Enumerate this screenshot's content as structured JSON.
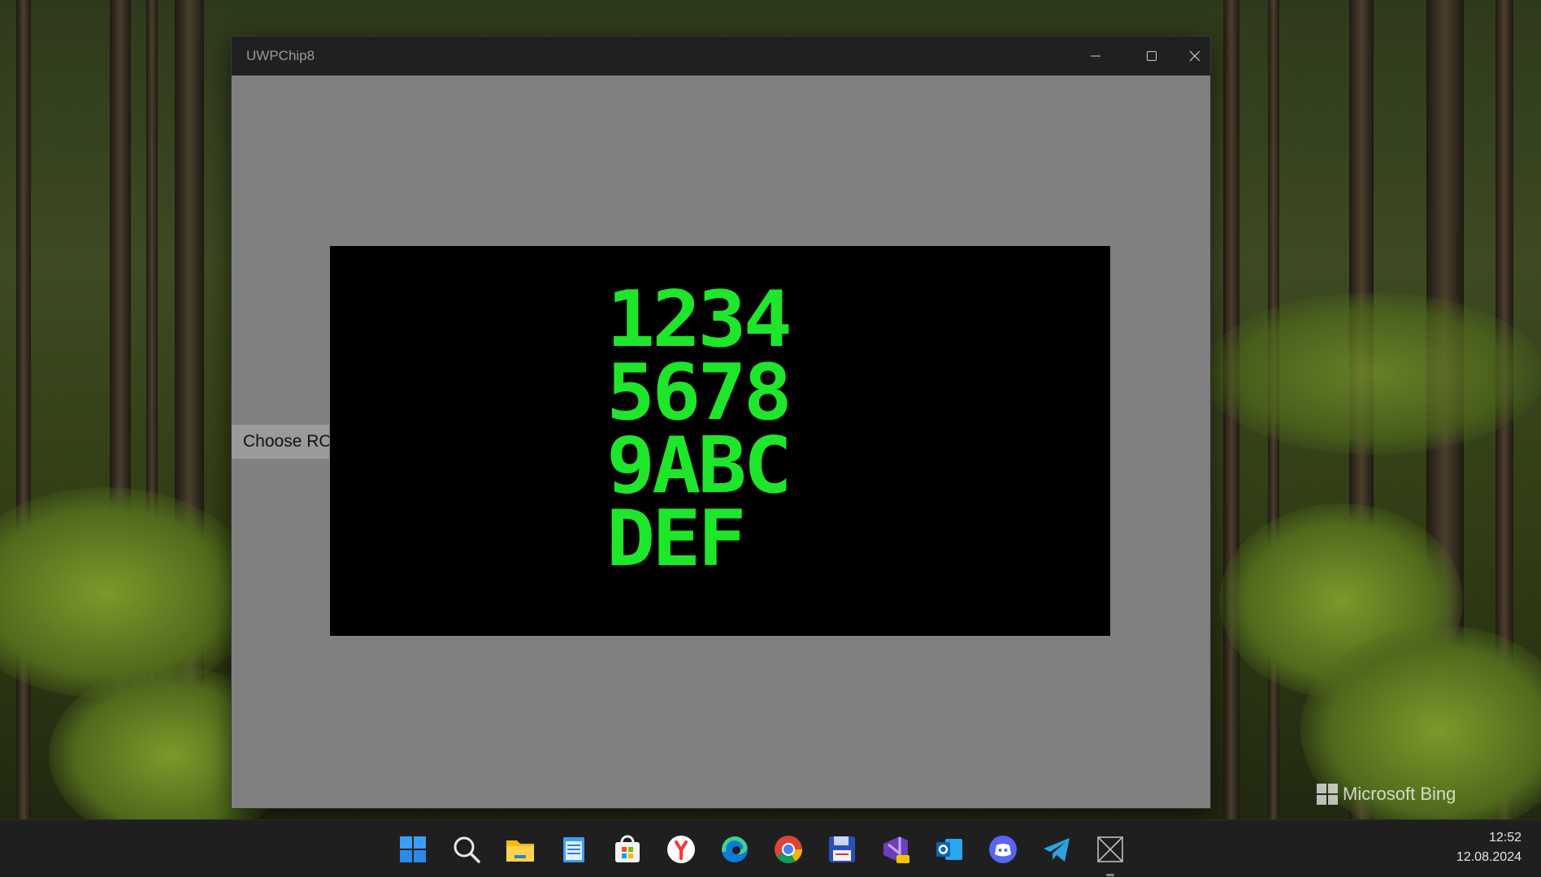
{
  "window": {
    "title": "UWPChip8",
    "minimize_icon": "minimize-icon",
    "maximize_icon": "maximize-icon",
    "close_icon": "close-icon",
    "choose_rom_label": "Choose ROM"
  },
  "display": {
    "lines": [
      "1234",
      "5678",
      "9ABC",
      "DEF"
    ],
    "pixel_color": "#1ee62a",
    "background_color": "#000000"
  },
  "wallpaper": {
    "watermark": "Microsoft Bing"
  },
  "taskbar": {
    "icons": [
      "windows-start-icon",
      "search-icon",
      "file-explorer-icon",
      "notepad-icon",
      "microsoft-store-icon",
      "yandex-browser-icon",
      "edge-icon",
      "chrome-icon",
      "save-disk-app-icon",
      "visual-studio-preview-icon",
      "outlook-icon",
      "discord-icon",
      "telegram-icon",
      "uwpchip8-app-icon"
    ],
    "time": "12:52",
    "date": "12.08.2024"
  }
}
